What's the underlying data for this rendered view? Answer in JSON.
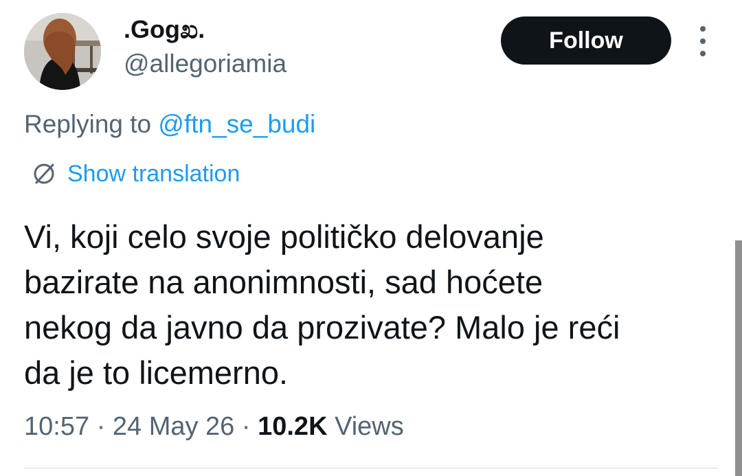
{
  "user": {
    "display_name": ".Gogಖ.",
    "handle": "@allegoriamia"
  },
  "actions": {
    "follow_label": "Follow",
    "more_icon": "more-vertical-icon"
  },
  "reply": {
    "prefix": "Replying to ",
    "mention": "@ftn_se_budi"
  },
  "translation": {
    "icon": "globe-icon",
    "label": "Show translation"
  },
  "tweet": {
    "text": "Vi, koji celo svoje političko delovanje\nbazirate na  anonimnosti, sad hoćete\nnekog da javno da prozivate? Malo je reći\nda je to licemerno."
  },
  "meta": {
    "time": "10:57",
    "separator": " · ",
    "date": "24 May 26",
    "views_count": "10.2K",
    "views_label": " Views"
  },
  "colors": {
    "text_primary": "#0f1419",
    "text_secondary": "#536471",
    "accent": "#1d9bf0",
    "button_bg": "#0f1419"
  }
}
